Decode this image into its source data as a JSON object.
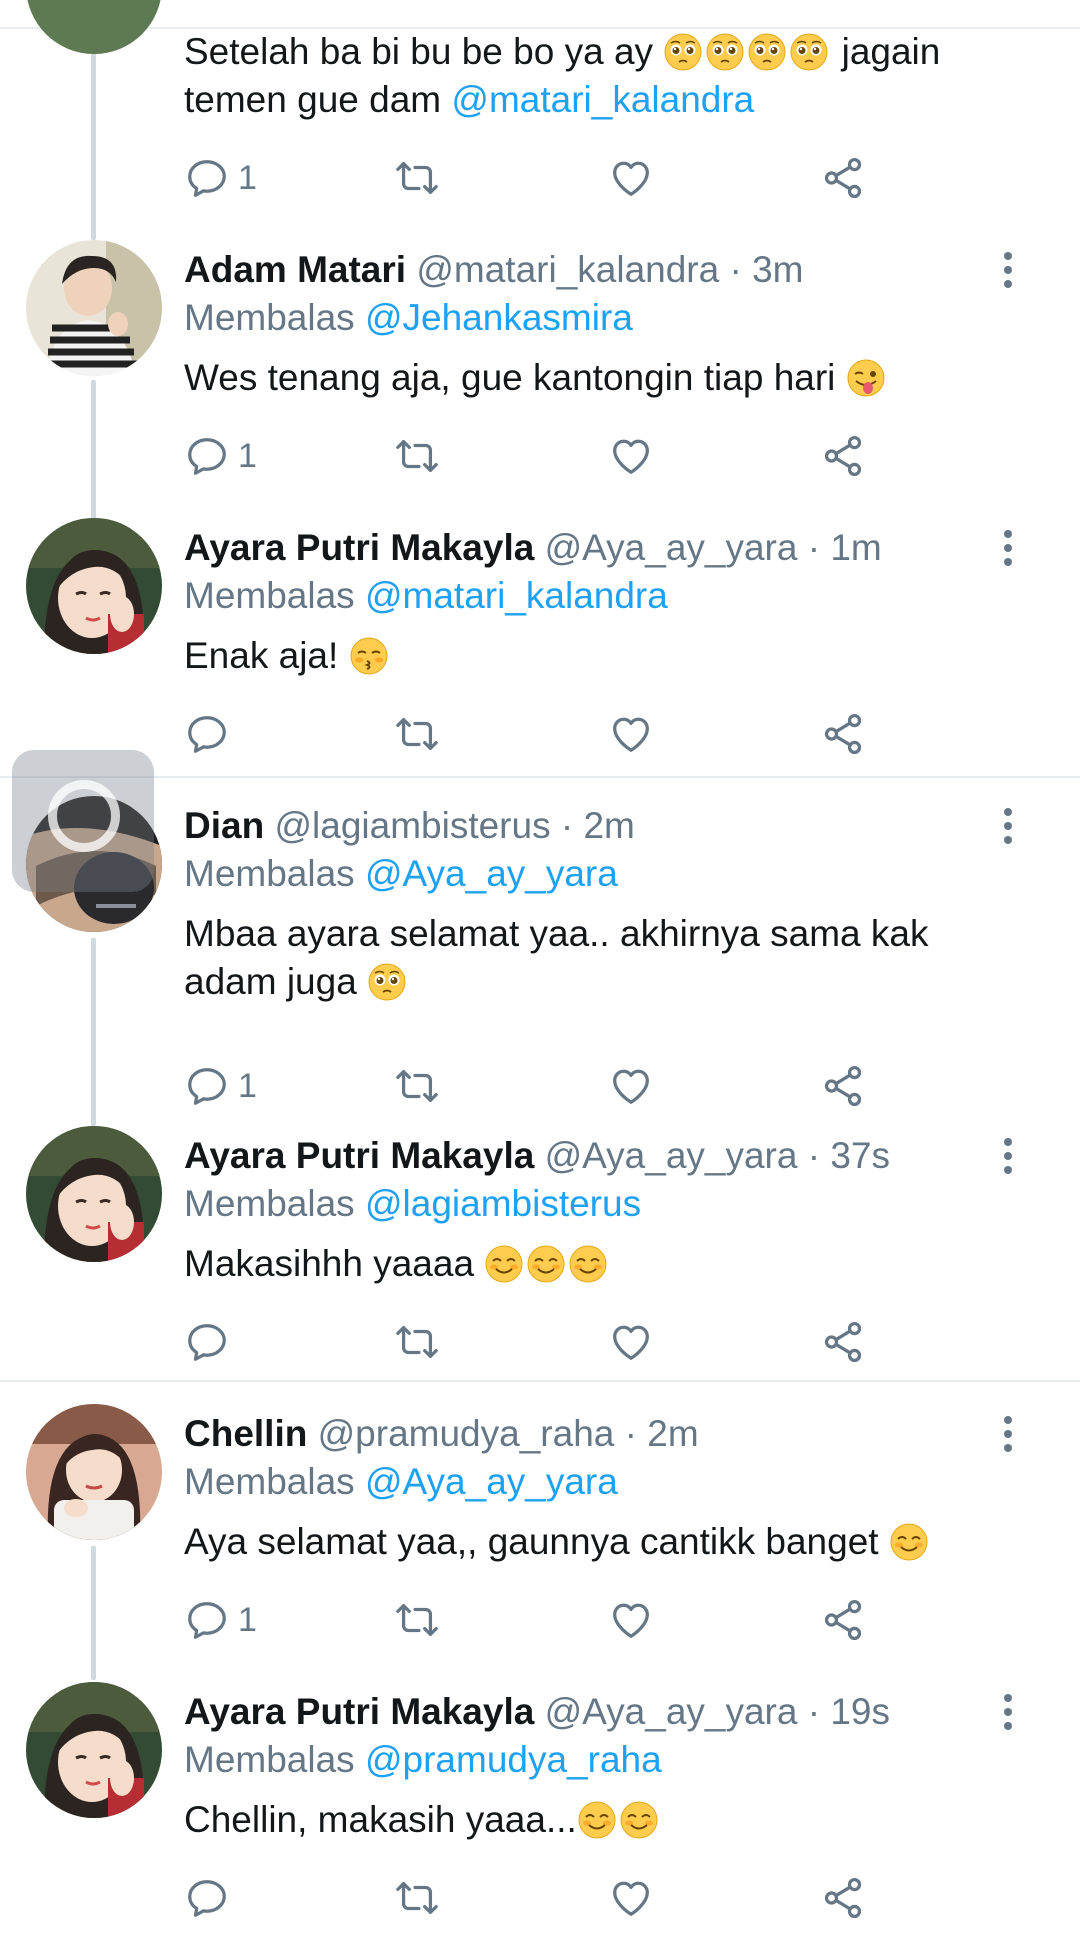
{
  "colors": {
    "text": "#14171a",
    "secondary": "#657786",
    "link": "#1da1f2",
    "divider": "#e6ecf0",
    "thread_line": "#cfd9de"
  },
  "icons": {
    "reply": "reply-icon",
    "retweet": "retweet-icon",
    "like": "heart-icon",
    "share": "share-icon",
    "more": "more-vertical-icon"
  },
  "tweets": [
    {
      "body_prefix": "Setelah ba bi bu be bo ya ay",
      "body_emoji": "pleading-face x4",
      "body_suffix": "jagain temen gue dam",
      "body_mention": "@matari_kalandra",
      "reply_count": "1"
    },
    {
      "name": "Adam Matari",
      "handle": "@matari_kalandra",
      "time": "· 3m",
      "reply_label": "Membalas",
      "reply_to": "@Jehankasmira",
      "text": "Wes tenang aja, gue kantongin tiap hari",
      "emoji": "winking-tongue-face",
      "reply_count": "1"
    },
    {
      "name": "Ayara Putri Makayla",
      "handle": "@Aya_ay_yara",
      "time": "· 1m",
      "reply_label": "Membalas",
      "reply_to": "@matari_kalandra",
      "text": "Enak aja!",
      "emoji": "kissing-face",
      "reply_count": ""
    },
    {
      "name": "Dian",
      "handle": "@lagiambisterus",
      "time": "· 2m",
      "reply_label": "Membalas",
      "reply_to": "@Aya_ay_yara",
      "text_line1": "Mbaa ayara selamat yaa.. akhirnya sama kak",
      "text_line2": "adam juga",
      "emoji": "pleading-face",
      "reply_count": "1"
    },
    {
      "name": "Ayara Putri Makayla",
      "handle": "@Aya_ay_yara",
      "time": "· 37s",
      "reply_label": "Membalas",
      "reply_to": "@lagiambisterus",
      "text": "Makasihhh yaaaa",
      "emoji": "smiling-face x3",
      "reply_count": ""
    },
    {
      "name": "Chellin",
      "handle": "@pramudya_raha",
      "time": "· 2m",
      "reply_label": "Membalas",
      "reply_to": "@Aya_ay_yara",
      "text": "Aya selamat yaa,, gaunnya cantikk banget",
      "emoji": "smiling-face",
      "reply_count": "1"
    },
    {
      "name": "Ayara Putri Makayla",
      "handle": "@Aya_ay_yara",
      "time": "· 19s",
      "reply_label": "Membalas",
      "reply_to": "@pramudya_raha",
      "text": "Chellin, makasih yaaa...",
      "emoji": "smiling-face x2",
      "reply_count": ""
    }
  ]
}
